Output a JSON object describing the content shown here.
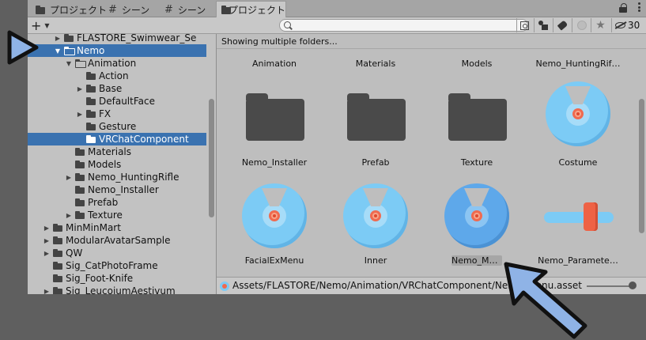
{
  "tabs": [
    {
      "label": "プロジェクト",
      "icon": "folder-icon"
    },
    {
      "label": "シーン",
      "icon": "hash-icon"
    },
    {
      "label": "シーン",
      "icon": "hash-icon"
    },
    {
      "label": "プロジェクト",
      "icon": "folder-icon"
    }
  ],
  "toolbar": {
    "add_label": "+",
    "search_value": "",
    "hidden_count": "30"
  },
  "tree": [
    {
      "label": "FLASTORE_Swimwear_Se",
      "arrow": "collapsed",
      "open": false,
      "selected": false
    },
    {
      "label": "Nemo",
      "arrow": "expanded",
      "open": true,
      "selected": true
    },
    {
      "label": "Animation",
      "arrow": "expanded",
      "open": true,
      "selected": false
    },
    {
      "label": "Action",
      "arrow": "none",
      "open": false,
      "selected": false
    },
    {
      "label": "Base",
      "arrow": "collapsed",
      "open": false,
      "selected": false
    },
    {
      "label": "DefaultFace",
      "arrow": "none",
      "open": false,
      "selected": false
    },
    {
      "label": "FX",
      "arrow": "collapsed",
      "open": false,
      "selected": false
    },
    {
      "label": "Gesture",
      "arrow": "none",
      "open": false,
      "selected": false
    },
    {
      "label": "VRChatComponent",
      "arrow": "none",
      "open": false,
      "selected": true
    },
    {
      "label": "Materials",
      "arrow": "none",
      "open": false,
      "selected": false
    },
    {
      "label": "Models",
      "arrow": "none",
      "open": false,
      "selected": false
    },
    {
      "label": "Nemo_HuntingRifle",
      "arrow": "collapsed",
      "open": false,
      "selected": false
    },
    {
      "label": "Nemo_Installer",
      "arrow": "none",
      "open": false,
      "selected": false
    },
    {
      "label": "Prefab",
      "arrow": "none",
      "open": false,
      "selected": false
    },
    {
      "label": "Texture",
      "arrow": "collapsed",
      "open": false,
      "selected": false
    },
    {
      "label": "MinMinMart",
      "arrow": "collapsed",
      "open": false,
      "selected": false
    },
    {
      "label": "ModularAvatarSample",
      "arrow": "collapsed",
      "open": false,
      "selected": false
    },
    {
      "label": "QW",
      "arrow": "collapsed",
      "open": false,
      "selected": false
    },
    {
      "label": "Sig_CatPhotoFrame",
      "arrow": "none",
      "open": false,
      "selected": false
    },
    {
      "label": "Sig_Foot-Knife",
      "arrow": "none",
      "open": false,
      "selected": false
    },
    {
      "label": "Sig_LeucojumAestivum",
      "arrow": "collapsed",
      "open": false,
      "selected": false
    }
  ],
  "right": {
    "header": "Showing multiple folders...",
    "top_labels": [
      "Animation",
      "Materials",
      "Models",
      "Nemo_HuntingRif…"
    ],
    "row1": [
      {
        "label": "Nemo_Installer",
        "icon": "folder-icon"
      },
      {
        "label": "Prefab",
        "icon": "folder-icon"
      },
      {
        "label": "Texture",
        "icon": "folder-icon"
      },
      {
        "label": "Costume",
        "icon": "expressions-menu-icon"
      }
    ],
    "row2": [
      {
        "label": "FacialExMenu",
        "icon": "expressions-menu-icon"
      },
      {
        "label": "Inner",
        "icon": "expressions-menu-icon"
      },
      {
        "label": "Nemo_Menu",
        "icon": "expressions-menu-icon",
        "selected": true
      },
      {
        "label": "Nemo_Paramete…",
        "icon": "expression-parameters-icon"
      }
    ],
    "status_path": "Assets/FLASTORE/Nemo/Animation/VRChatComponent/Nemo_Menu.asset"
  },
  "colors": {
    "selection": "#3a72b0",
    "menu_icon": "#7ccbf5",
    "accent_red": "#f06a4f",
    "annotation_arrow": "#8fb3e6"
  }
}
